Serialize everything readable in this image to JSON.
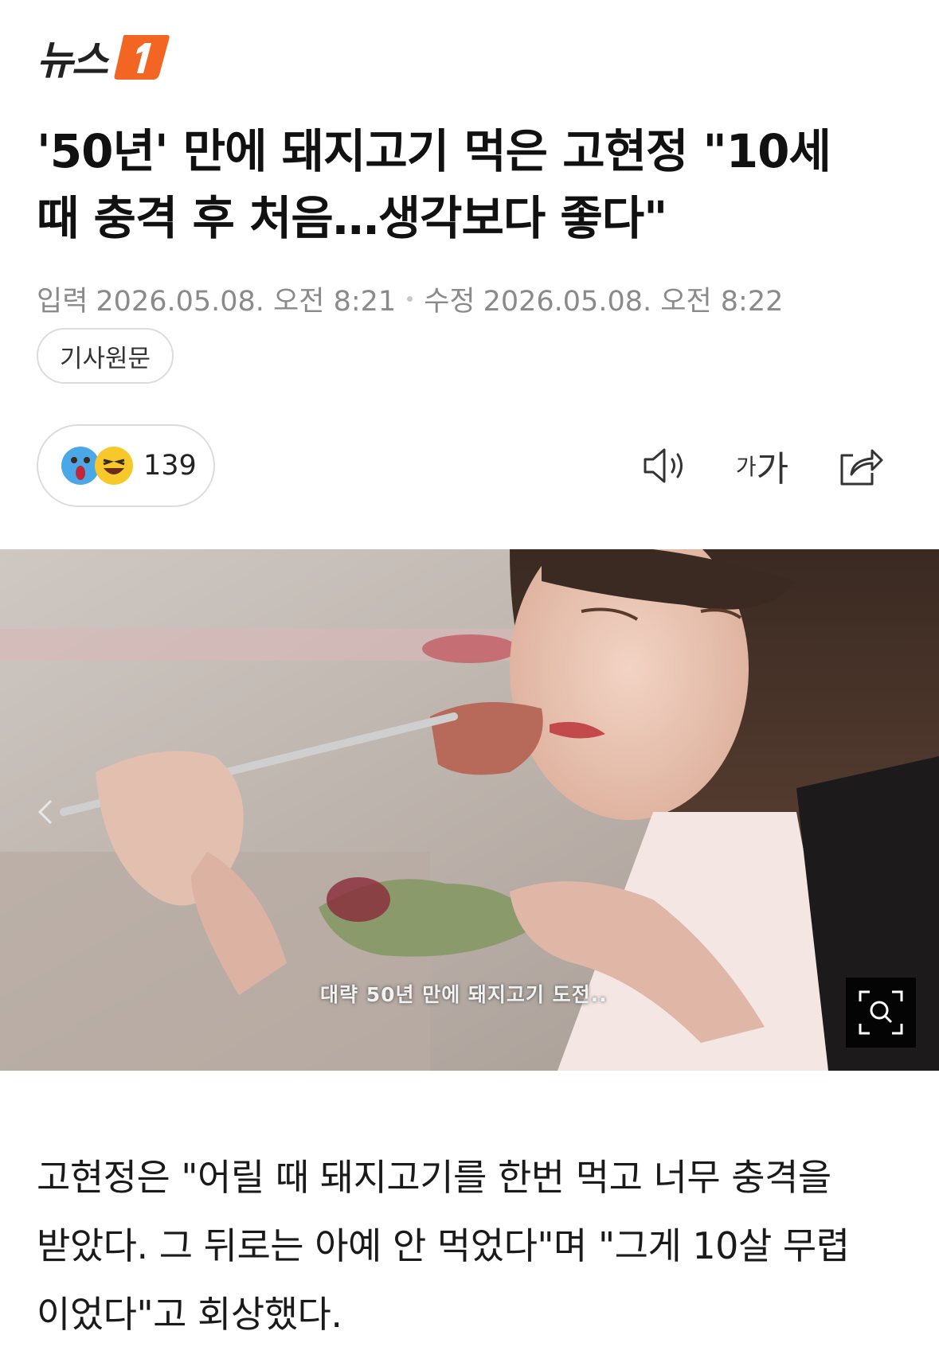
{
  "header": {
    "logo_text": "뉴스",
    "logo_mark": "1"
  },
  "article": {
    "title_line1": "'50년' 만에 돼지고기 먹은 고현정 \"10세",
    "title_line2": "때 충격 후 처음…생각보다 좋다\"",
    "input_label": "입력",
    "input_time": "2026.05.08. 오전 8:21",
    "edit_label": "수정",
    "edit_time": "2026.05.08. 오전 8:22",
    "original_button": "기사원문"
  },
  "toolbar": {
    "reaction_count": "139",
    "reaction_icons": [
      "shocked-face-icon",
      "laughing-face-icon"
    ],
    "font_small": "가",
    "font_large": "가"
  },
  "photo": {
    "caption": "대략 50년 만에 돼지고기 도전.."
  },
  "body": {
    "line1": "고현정은 \"어릴 때 돼지고기를 한번 먹고 너무 충격을",
    "line2": "받았다. 그 뒤로는 아예 안 먹었다\"며 \"그게 10살 무렵",
    "line3": "이었다\"고 회상했다."
  },
  "colors": {
    "brand_orange": "#f26522",
    "meta_gray": "#8a8a8a",
    "pill_border": "#dcdcdc"
  }
}
